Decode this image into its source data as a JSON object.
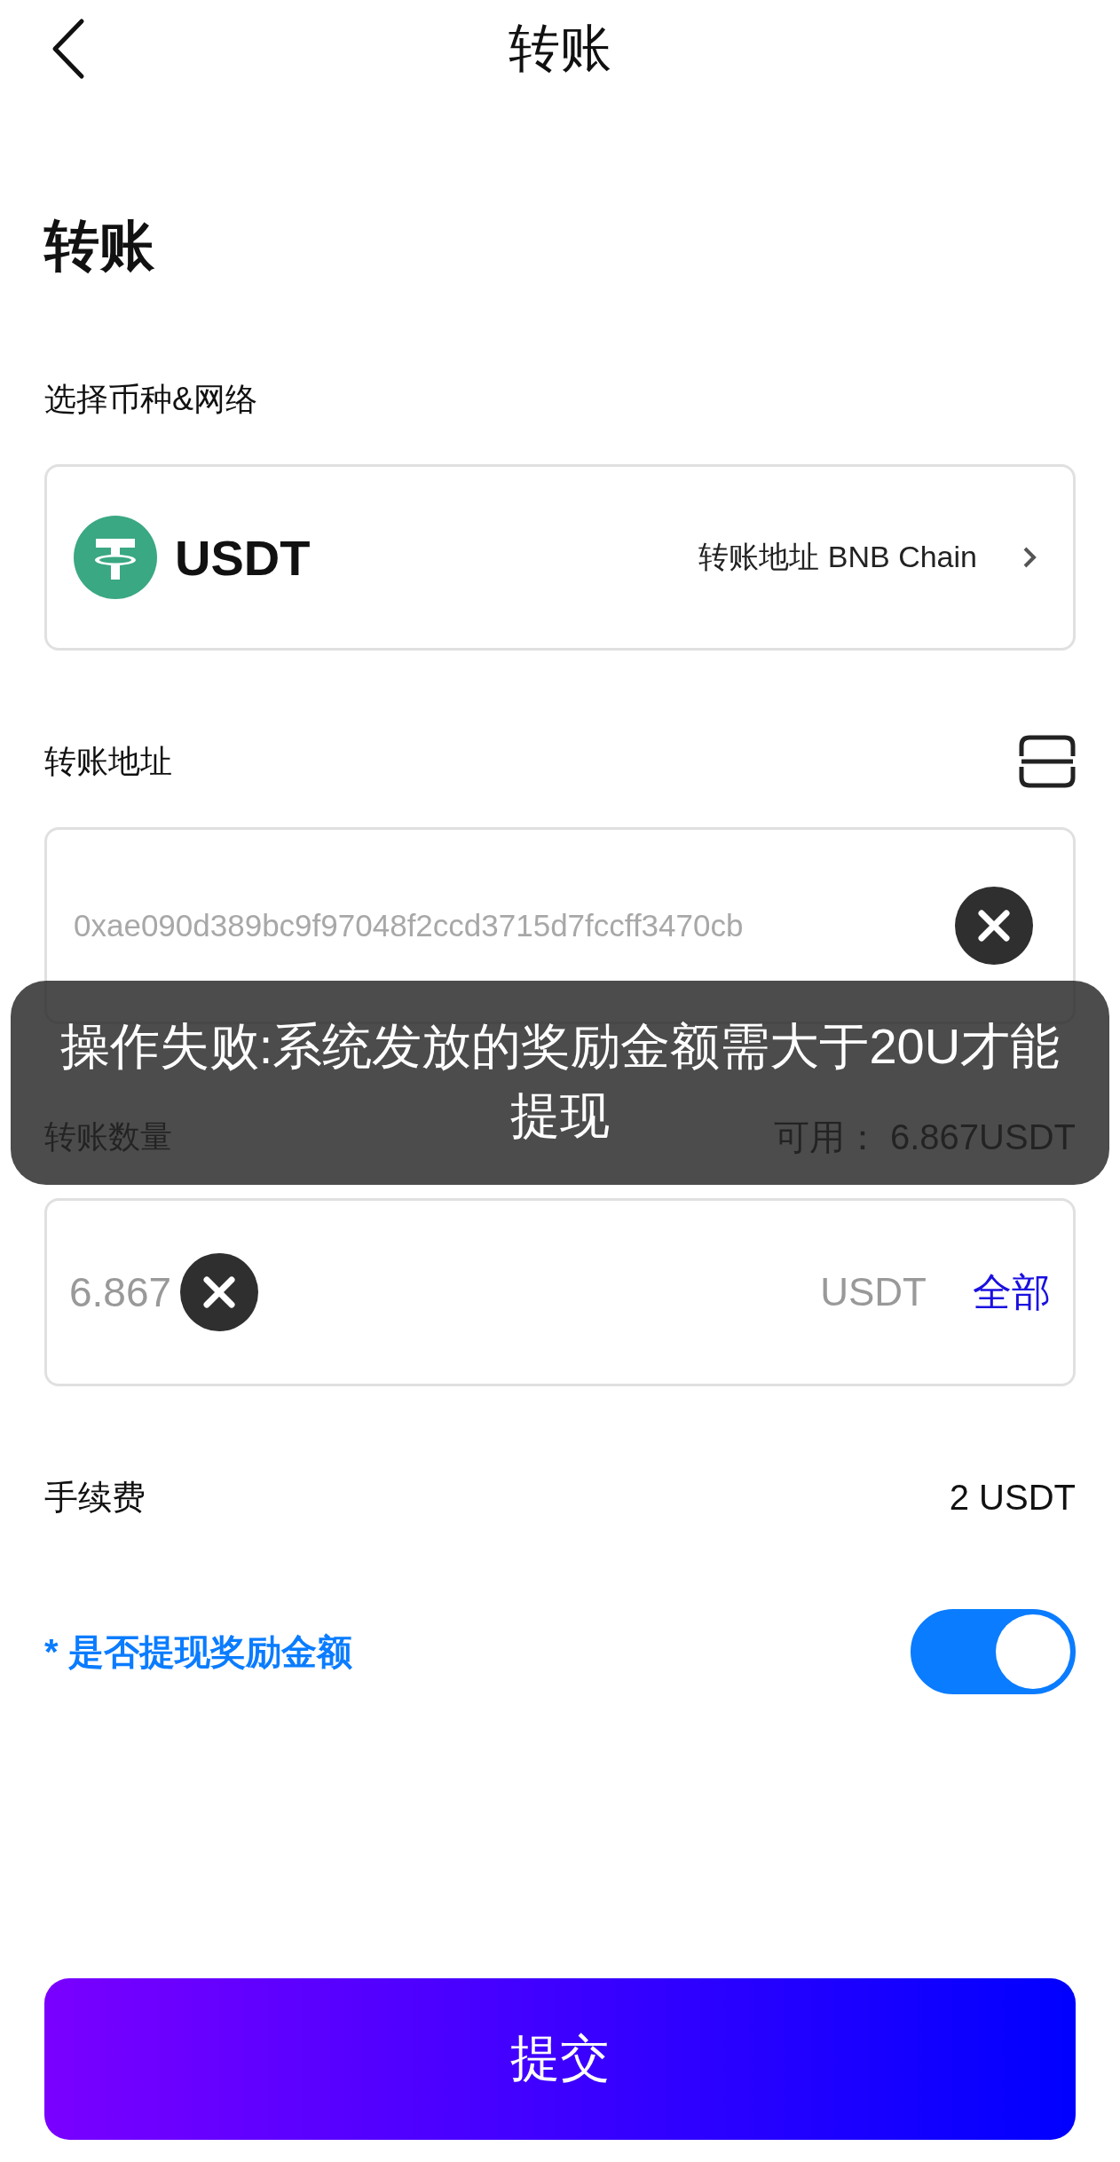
{
  "header": {
    "title": "转账"
  },
  "heading": "转账",
  "coin_label": "选择币种&网络",
  "coin": {
    "symbol": "USDT",
    "network": "转账地址 BNB Chain"
  },
  "address_label": "转账地址",
  "address": {
    "value": "0xae090d389bc9f97048f2ccd3715d7fccff3470cb"
  },
  "amount_label": "转账数量",
  "available": "可用：  6.867USDT",
  "amount": {
    "value": "6.867",
    "unit": "USDT",
    "all": "全部"
  },
  "fee": {
    "label": "手续费",
    "value": "2 USDT"
  },
  "reward": {
    "label": "* 是否提现奖励金额",
    "on": true
  },
  "submit": "提交",
  "toast": "操作失败:系统发放的奖励金额需大于20U才能提现"
}
